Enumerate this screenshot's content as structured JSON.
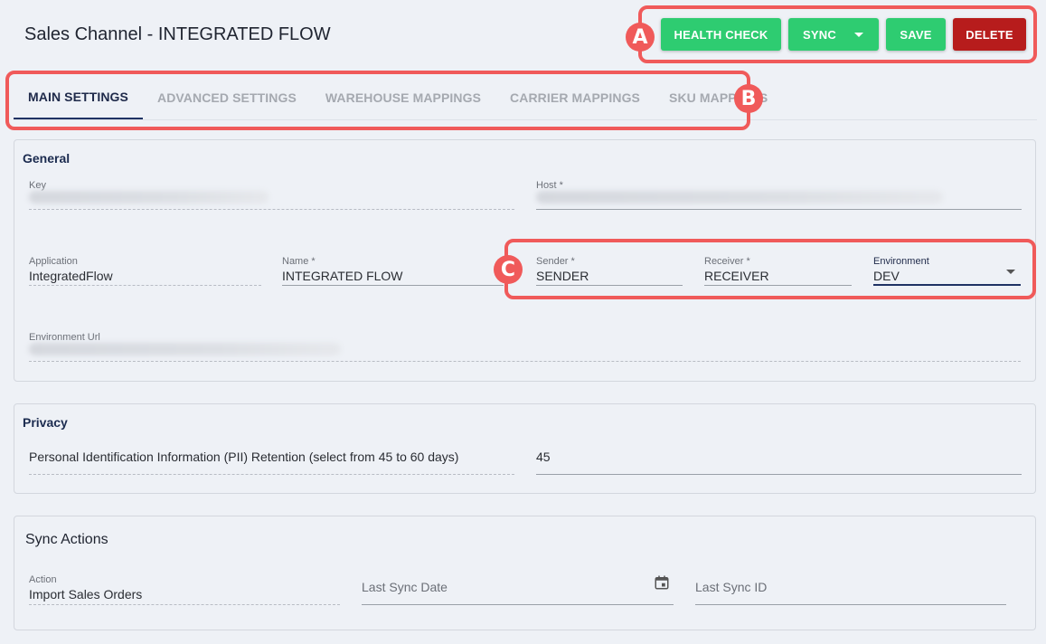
{
  "header": {
    "title": "Sales Channel - INTEGRATED FLOW"
  },
  "toolbar": {
    "health_check_label": "HEALTH CHECK",
    "sync_label": "SYNC",
    "save_label": "SAVE",
    "delete_label": "DELETE"
  },
  "annotations": {
    "a": "A",
    "b": "B",
    "c": "C"
  },
  "tabs": [
    {
      "label": "MAIN SETTINGS",
      "active": true
    },
    {
      "label": "ADVANCED SETTINGS"
    },
    {
      "label": "WAREHOUSE MAPPINGS"
    },
    {
      "label": "CARRIER MAPPINGS"
    },
    {
      "label": "SKU MAPPINGS"
    }
  ],
  "general": {
    "title": "General",
    "key_label": "Key",
    "host_label": "Host *",
    "application_label": "Application",
    "application_value": "IntegratedFlow",
    "name_label": "Name *",
    "name_value": "INTEGRATED FLOW",
    "sender_label": "Sender *",
    "sender_value": "SENDER",
    "receiver_label": "Receiver *",
    "receiver_value": "RECEIVER",
    "environment_label": "Environment",
    "environment_value": "DEV",
    "environment_url_label": "Environment Url"
  },
  "privacy": {
    "title": "Privacy",
    "pii_label": "Personal Identification Information (PII) Retention (select from 45 to 60 days)",
    "pii_value": "45"
  },
  "sync_actions": {
    "title": "Sync Actions",
    "action_label": "Action",
    "action_value": "Import Sales Orders",
    "last_sync_date_placeholder": "Last Sync Date",
    "last_sync_id_placeholder": "Last Sync ID"
  },
  "colors": {
    "accent_green": "#2ecc71",
    "danger_red": "#b71c1c",
    "annotation": "#f05a5a",
    "primary_navy": "#1f3264"
  },
  "icons": {
    "calendar": "calendar-icon",
    "dropdown": "chevron-down-icon"
  }
}
